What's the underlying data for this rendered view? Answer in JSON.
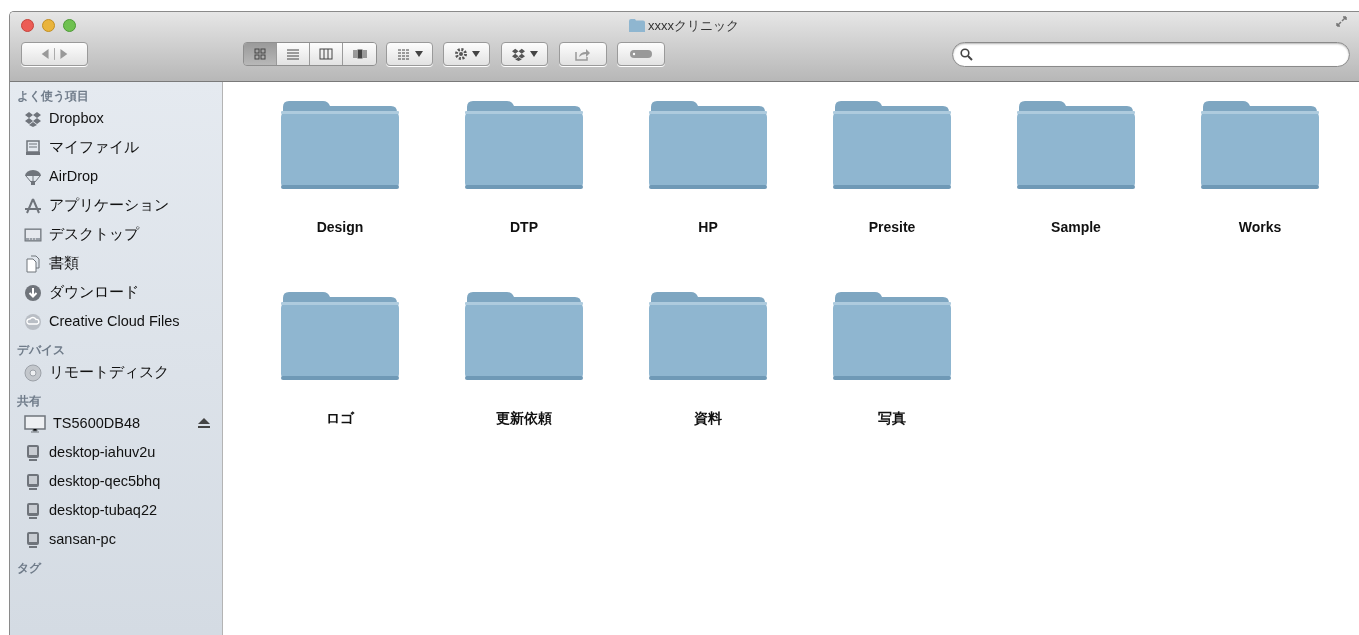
{
  "window": {
    "title": "xxxxクリニック"
  },
  "toolbar": {
    "view_modes": [
      {
        "kind": "icons",
        "selected": true
      },
      {
        "kind": "list",
        "selected": false
      },
      {
        "kind": "columns",
        "selected": false
      },
      {
        "kind": "coverflow",
        "selected": false
      }
    ]
  },
  "sidebar": {
    "sections": [
      {
        "title": "よく使う項目",
        "items": [
          {
            "label": "Dropbox",
            "kind": "dropbox",
            "ejectable": false
          },
          {
            "label": "マイファイル",
            "kind": "files",
            "ejectable": false
          },
          {
            "label": "AirDrop",
            "kind": "airdrop",
            "ejectable": false
          },
          {
            "label": "アプリケーション",
            "kind": "apps",
            "ejectable": false
          },
          {
            "label": "デスクトップ",
            "kind": "desktop",
            "ejectable": false
          },
          {
            "label": "書類",
            "kind": "documents",
            "ejectable": false
          },
          {
            "label": "ダウンロード",
            "kind": "download",
            "ejectable": false
          },
          {
            "label": "Creative Cloud Files",
            "kind": "cloud",
            "ejectable": false
          }
        ]
      },
      {
        "title": "デバイス",
        "items": [
          {
            "label": "リモートディスク",
            "kind": "disc",
            "ejectable": false
          }
        ]
      },
      {
        "title": "共有",
        "items": [
          {
            "label": "TS5600DB48",
            "kind": "display",
            "ejectable": true
          },
          {
            "label": "desktop-iahuv2u",
            "kind": "pc",
            "ejectable": false
          },
          {
            "label": "desktop-qec5bhq",
            "kind": "pc",
            "ejectable": false
          },
          {
            "label": "desktop-tubaq22",
            "kind": "pc",
            "ejectable": false
          },
          {
            "label": "sansan-pc",
            "kind": "pc",
            "ejectable": false
          }
        ]
      },
      {
        "title": "タグ"
      }
    ]
  },
  "folders": [
    {
      "name": "Design"
    },
    {
      "name": "DTP"
    },
    {
      "name": "HP"
    },
    {
      "name": "Presite"
    },
    {
      "name": "Sample"
    },
    {
      "name": "Works"
    },
    {
      "name": "ロゴ"
    },
    {
      "name": "更新依頼"
    },
    {
      "name": "資料"
    },
    {
      "name": "写真"
    }
  ]
}
